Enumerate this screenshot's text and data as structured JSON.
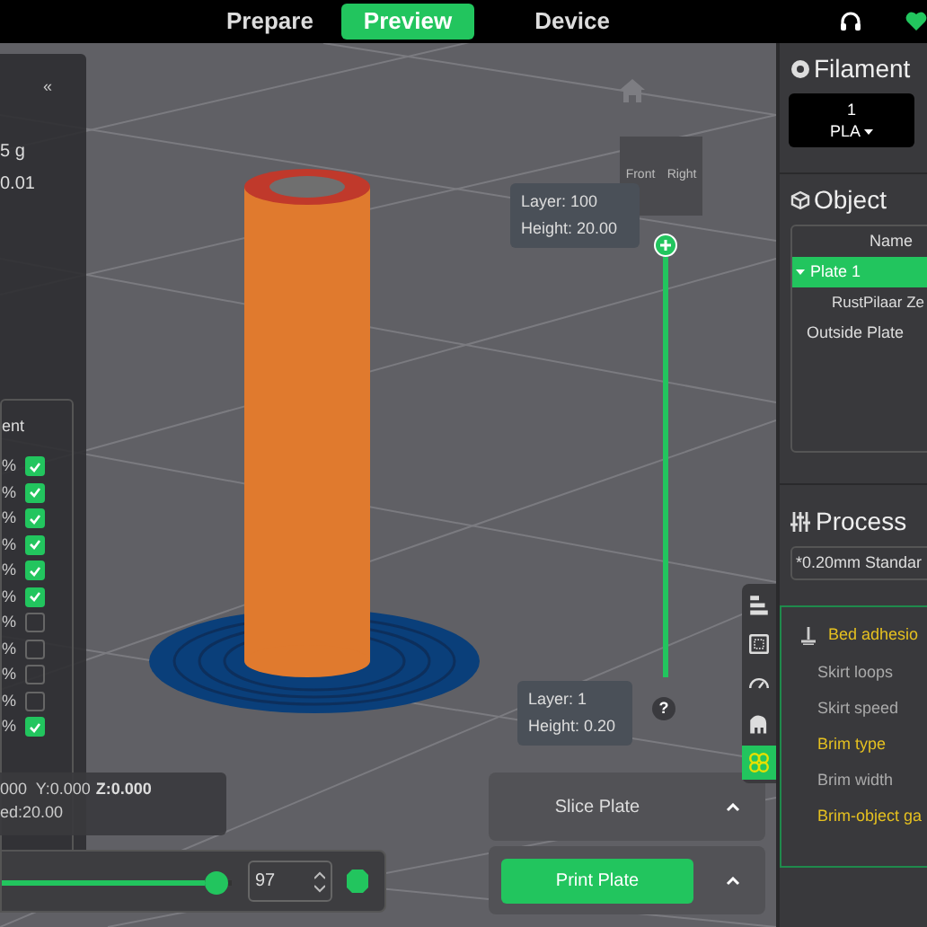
{
  "top_tabs": [
    {
      "label": "Prepare",
      "selected": false
    },
    {
      "label": "Preview",
      "selected": true
    },
    {
      "label": "Device",
      "selected": false
    }
  ],
  "stats_panel": {
    "collapse": "«",
    "values": [
      "5 g",
      "0.01"
    ],
    "legend_header": "ent",
    "legend_rows": [
      {
        "percent": "%",
        "checked": true
      },
      {
        "percent": "%",
        "checked": true
      },
      {
        "percent": "%",
        "checked": true
      },
      {
        "percent": "%",
        "checked": true
      },
      {
        "percent": "%",
        "checked": true
      },
      {
        "percent": "%",
        "checked": true
      },
      {
        "percent": "%",
        "checked": false
      },
      {
        "percent": "%",
        "checked": false
      },
      {
        "percent": "%",
        "checked": false
      },
      {
        "percent": "%",
        "checked": false
      },
      {
        "percent": "%",
        "checked": true
      }
    ]
  },
  "position": {
    "coords": "000  Y:0.000",
    "z": "Z:0.000",
    "speed": "ed:20.00"
  },
  "layer_slider": {
    "top": {
      "layer": "Layer: 100",
      "height": "Height: 20.00"
    },
    "bottom": {
      "layer": "Layer: 1",
      "height": "Height: 0.20"
    },
    "help": "?"
  },
  "move_slider": {
    "level": 0.93,
    "value": "97"
  },
  "nav_cube": {
    "front": "Front",
    "right": "Right"
  },
  "actions": [
    {
      "label": "Slice Plate",
      "kind": "plain"
    },
    {
      "label": "Print Plate",
      "kind": "primary"
    }
  ],
  "side_toolbar": [
    {
      "selected": false
    },
    {
      "selected": false
    },
    {
      "selected": false
    },
    {
      "selected": false
    },
    {
      "selected": true
    }
  ],
  "filament": {
    "title": "Filament",
    "slot": "1",
    "type": "PLA"
  },
  "object": {
    "title": "Object",
    "column": "Name",
    "tree": [
      {
        "label": "Plate 1",
        "selected": true,
        "expanded": true,
        "children": [
          {
            "label": "RustPilaar Ze",
            "selected": false
          }
        ]
      },
      {
        "label": "Outside Plate",
        "selected": false
      }
    ]
  },
  "process": {
    "title": "Process",
    "preset": "*0.20mm Standar",
    "group": "Bed adhesio",
    "settings": [
      {
        "label": "Skirt loops",
        "modified": false
      },
      {
        "label": "Skirt speed",
        "modified": false
      },
      {
        "label": "Brim type",
        "modified": true
      },
      {
        "label": "Brim width",
        "modified": false
      },
      {
        "label": "Brim-object ga",
        "modified": true
      }
    ]
  }
}
